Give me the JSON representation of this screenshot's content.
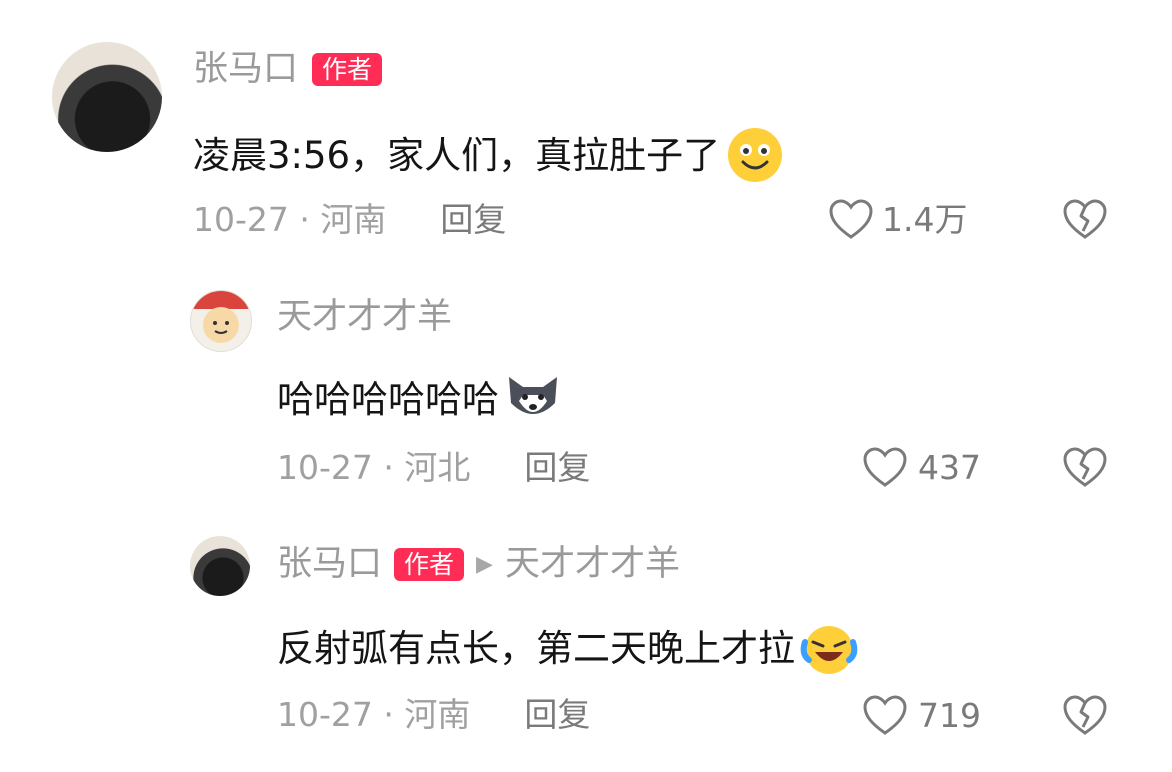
{
  "comments": [
    {
      "author": "张马口",
      "badge": "作者",
      "text": "凌晨3:56，家人们，真拉肚子了",
      "emoji": "smile-emoji",
      "meta": "10-27 · 河南",
      "reply_label": "回复",
      "likes": "1.4万"
    },
    {
      "author": "天才才才羊",
      "text": "哈哈哈哈哈哈",
      "emoji": "husky-emoji",
      "meta": "10-27 · 河北",
      "reply_label": "回复",
      "likes": "437"
    },
    {
      "author": "张马口",
      "badge": "作者",
      "reply_to": "天才才才羊",
      "text": "反射弧有点长，第二天晚上才拉",
      "emoji": "laugh-cry-emoji",
      "meta": "10-27 · 河南",
      "reply_label": "回复",
      "likes": "719"
    }
  ],
  "colors": {
    "badge": "#ff2d55",
    "secondary_text": "#9a9a9a"
  }
}
